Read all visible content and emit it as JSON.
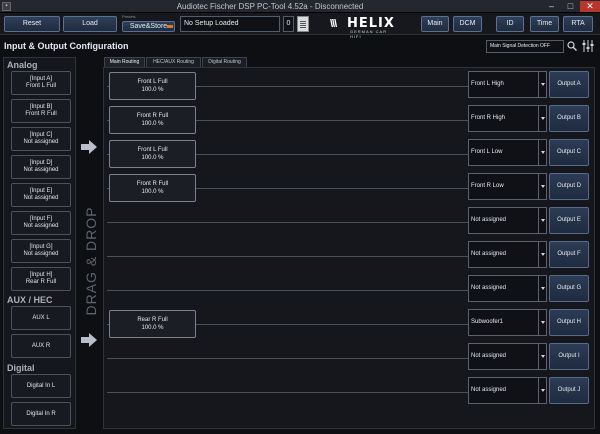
{
  "window": {
    "title": "Audiotec Fischer DSP PC-Tool 4.52a - Disconnected"
  },
  "toolbar": {
    "reset": "Reset",
    "load": "Load",
    "preset_label": "Presets",
    "save_store": "Save&Store",
    "setup_name": "No Setup Loaded",
    "preset_number": "0",
    "logo_word": "HELIX",
    "logo_tagline": "GERMAN CAR HIFI",
    "nav": [
      "Main",
      "DCM",
      "ID",
      "Time",
      "RTA"
    ]
  },
  "header": {
    "title": "Input & Output Configuration",
    "signal_detection": "Main Signal Detection OFF"
  },
  "inputs": {
    "analog_title": "Analog",
    "analog": [
      {
        "id": "[Input A]",
        "name": "Front L Full"
      },
      {
        "id": "[Input B]",
        "name": "Front R Full"
      },
      {
        "id": "[Input C]",
        "name": "Not assigned"
      },
      {
        "id": "[Input D]",
        "name": "Not assigned"
      },
      {
        "id": "[Input E]",
        "name": "Not assigned"
      },
      {
        "id": "[Input F]",
        "name": "Not assigned"
      },
      {
        "id": "[Input G]",
        "name": "Not assigned"
      },
      {
        "id": "[Input H]",
        "name": "Rear R Full"
      }
    ],
    "aux_title": "AUX / HEC",
    "aux": [
      "AUX L",
      "AUX R"
    ],
    "digital_title": "Digital",
    "digital": [
      "Digital In L",
      "Digital In R"
    ]
  },
  "drag_drop": "DRAG & DROP",
  "tabs": [
    "Main Routing",
    "HEC/AUX Routing",
    "Digital Routing"
  ],
  "routing": [
    {
      "source": "Front L Full",
      "level": "100.0 %",
      "channel": "Front L High",
      "output": "Output A"
    },
    {
      "source": "Front R Full",
      "level": "100.0 %",
      "channel": "Front R High",
      "output": "Output B"
    },
    {
      "source": "Front L Full",
      "level": "100.0 %",
      "channel": "Front L Low",
      "output": "Output C"
    },
    {
      "source": "Front R Full",
      "level": "100.0 %",
      "channel": "Front R Low",
      "output": "Output D"
    },
    {
      "source": "",
      "level": "",
      "channel": "Not assigned",
      "output": "Output E"
    },
    {
      "source": "",
      "level": "",
      "channel": "Not assigned",
      "output": "Output F"
    },
    {
      "source": "",
      "level": "",
      "channel": "Not assigned",
      "output": "Output G"
    },
    {
      "source": "Rear R Full",
      "level": "100.0 %",
      "channel": "Subwoofer1",
      "output": "Output H"
    },
    {
      "source": "",
      "level": "",
      "channel": "Not assigned",
      "output": "Output I"
    },
    {
      "source": "",
      "level": "",
      "channel": "Not assigned",
      "output": "Output J"
    }
  ]
}
